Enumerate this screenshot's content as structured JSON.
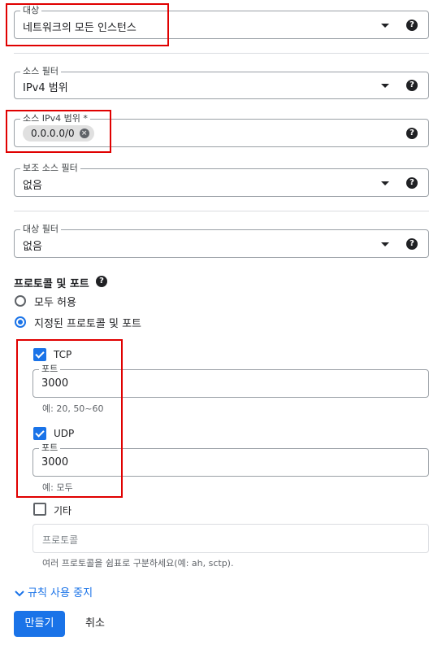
{
  "target": {
    "label": "대상",
    "value": "네트워크의 모든 인스턴스"
  },
  "source_filter": {
    "label": "소스 필터",
    "value": "IPv4 범위"
  },
  "source_ipv4": {
    "label": "소스 IPv4 범위 *",
    "chip": "0.0.0.0/0"
  },
  "secondary_source_filter": {
    "label": "보조 소스 필터",
    "value": "없음"
  },
  "destination_filter": {
    "label": "대상 필터",
    "value": "없음"
  },
  "protocols": {
    "title": "프로토콜 및 포트",
    "options": [
      "모두 허용",
      "지정된 프로토콜 및 포트"
    ],
    "selected": "지정된 프로토콜 및 포트",
    "tcp": {
      "label": "TCP",
      "checked": true,
      "port_label": "포트",
      "port_value": "3000",
      "hint": "예: 20, 50~60"
    },
    "udp": {
      "label": "UDP",
      "checked": true,
      "port_label": "포트",
      "port_value": "3000",
      "hint": "예: 모두"
    },
    "other": {
      "label": "기타",
      "checked": false,
      "placeholder": "프로토콜",
      "hint": "여러 프로토콜을 쉼표로 구분하세요(예: ah, sctp)."
    }
  },
  "disable_rule_link": "규칙 사용 중지",
  "buttons": {
    "create": "만들기",
    "cancel": "취소"
  },
  "icons": {
    "help": "help-icon",
    "dropdown": "dropdown-arrow-icon",
    "clear": "close-icon",
    "expand": "chevron-down-icon"
  },
  "colors": {
    "accent": "#1a73e8",
    "highlight": "#e00000"
  }
}
